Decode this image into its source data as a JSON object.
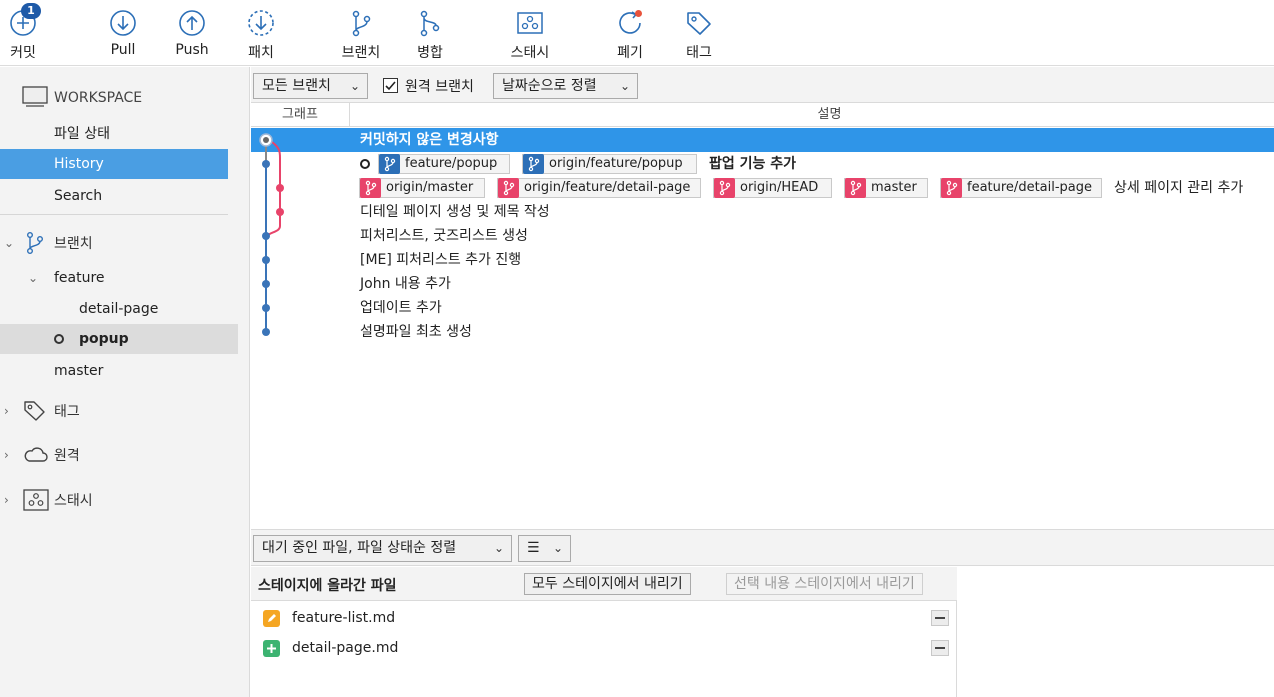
{
  "toolbar": {
    "commit": {
      "label": "커밋",
      "badge": "1"
    },
    "pull": {
      "label": "Pull"
    },
    "push": {
      "label": "Push"
    },
    "patch": {
      "label": "패치"
    },
    "branch": {
      "label": "브랜치"
    },
    "merge": {
      "label": "병합"
    },
    "stash": {
      "label": "스태시"
    },
    "discard": {
      "label": "폐기"
    },
    "tag": {
      "label": "태그"
    }
  },
  "sidebar": {
    "workspace": {
      "title": "WORKSPACE",
      "items": [
        {
          "label": "파일 상태"
        },
        {
          "label": "History"
        },
        {
          "label": "Search"
        }
      ]
    },
    "branches": {
      "title": "브랜치",
      "feature_group": "feature",
      "feature_children": [
        "detail-page",
        "popup"
      ],
      "master": "master"
    },
    "tags": {
      "title": "태그"
    },
    "remotes": {
      "title": "원격"
    },
    "stashes": {
      "title": "스태시"
    }
  },
  "filterbar": {
    "branch_filter": "모든 브랜치",
    "show_remote_label": "원격 브랜치",
    "show_remote_checked": true,
    "sort": "날짜순으로 정렬"
  },
  "table": {
    "col_graph": "그래프",
    "col_description": "설명"
  },
  "commits": [
    {
      "message": "커밋하지 않은 변경사항",
      "refs": []
    },
    {
      "message": "팝업 기능 추가",
      "refs": [
        "feature/popup",
        "origin/feature/popup"
      ]
    },
    {
      "message": "상세 페이지 관리 추가",
      "refs": [
        "origin/master",
        "origin/feature/detail-page",
        "origin/HEAD",
        "master",
        "feature/detail-page"
      ]
    },
    {
      "message": "디테일 페이지 생성 및 제목 작성",
      "refs": []
    },
    {
      "message": "피처리스트, 굿즈리스트 생성",
      "refs": []
    },
    {
      "message": "[ME] 피처리스트 추가 진행",
      "refs": []
    },
    {
      "message": "John 내용 추가",
      "refs": []
    },
    {
      "message": "업데이트 추가",
      "refs": []
    },
    {
      "message": "설명파일 최초 생성",
      "refs": []
    }
  ],
  "bottom": {
    "file_sort": "대기 중인 파일, 파일 상태순 정렬",
    "view_mode_icon": "list-icon",
    "staged_title": "스테이지에 올라간 파일",
    "unstage_all": "모두 스테이지에서 내리기",
    "unstage_selected": "선택 내용 스테이지에서 내리기",
    "files": [
      {
        "name": "feature-list.md",
        "status": "modified",
        "color": "#f5a623"
      },
      {
        "name": "detail-page.md",
        "status": "added",
        "color": "#3cb371"
      }
    ]
  },
  "colors": {
    "selection": "#2f95e8",
    "sidebar_selection": "#4a9ee3",
    "branch_blue": "#2c6fb7",
    "branch_pink": "#e8436a",
    "graph_blue": "#3a74b8",
    "graph_pink": "#e8436a"
  }
}
